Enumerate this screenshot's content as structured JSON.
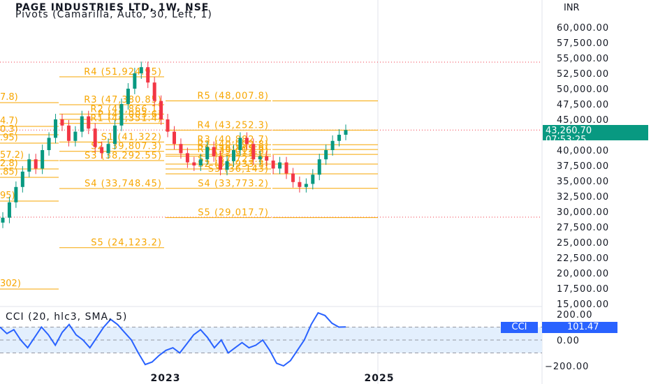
{
  "header": {
    "title": "PAGE INDUSTRIES LTD, 1W, NSE",
    "indicator": "Pivots (Camarilla, Auto, 30, Left, 1)"
  },
  "price_axis": {
    "currency": "INR",
    "ticks": [
      "60,000.00",
      "57,500.00",
      "55,000.00",
      "52,500.00",
      "50,000.00",
      "47,500.00",
      "45,000.00",
      "42,500.00",
      "40,000.00",
      "37,500.00",
      "35,000.00",
      "32,500.00",
      "30,000.00",
      "27,500.00",
      "25,000.00",
      "22,500.00",
      "20,000.00",
      "17,500.00",
      "15,000.00"
    ],
    "current_price": "43,260.70",
    "countdown": "07:53:25"
  },
  "time_axis": {
    "labels": [
      "2023",
      "2025"
    ]
  },
  "pivots": {
    "left_labels": [
      "7.8)",
      "4.7)",
      "0.3)",
      ".95)",
      "57.2)",
      "2.8)",
      ".85)",
      "95)",
      "302)"
    ],
    "period1": [
      {
        "label": "R4 (51,924.95)",
        "value": 51924.95
      },
      {
        "label": "R3 (47,380.85)",
        "value": 47380.85
      },
      {
        "label": "R2 (45,866.1)",
        "value": 45866.1
      },
      {
        "label": "R1 (44,351.4)",
        "value": 44351.4
      },
      {
        "label": "P (45,003.6)",
        "value": 45003.6
      },
      {
        "label": "S1 (41,322)",
        "value": 41322
      },
      {
        "label": "S2 (39,807.3)",
        "value": 39807.3
      },
      {
        "label": "S3 (38,292.55)",
        "value": 38292.55
      },
      {
        "label": "S4 (33,748.45)",
        "value": 33748.45
      },
      {
        "label": "S5 (24,123.2)",
        "value": 24123.2
      }
    ],
    "period2": [
      {
        "label": "R5 (48,007.8)",
        "value": 48007.8
      },
      {
        "label": "R4 (43,252.3)",
        "value": 43252.3
      },
      {
        "label": "R3 (40,882.7)",
        "value": 40882.7
      },
      {
        "label": "R2 (40,092.8)",
        "value": 40092.8
      },
      {
        "label": "R1 (39,302.9)",
        "value": 39302.9
      },
      {
        "label": "P (39,011.8)",
        "value": 39011.8
      },
      {
        "label": "S1 (37,723.2)",
        "value": 37723.2
      },
      {
        "label": "S2 (36,933.3)",
        "value": 36933.3
      },
      {
        "label": "S3 (36,143)",
        "value": 36143
      },
      {
        "label": "S4 (33,773.2)",
        "value": 33773.2
      },
      {
        "label": "S5 (29,017.7)",
        "value": 29017.7
      }
    ]
  },
  "cci": {
    "label": "CCI (20, hlc3, SMA, 5)",
    "badge_name": "CCI",
    "badge_value": "101.47",
    "ticks": [
      "200.00",
      "0.00",
      "−200.00"
    ]
  },
  "colors": {
    "up": "#089981",
    "down": "#f23645",
    "pivot": "#f7a600",
    "cci_line": "#2962ff",
    "cci_band": "#e3effd"
  },
  "chart_data": {
    "type": "candlestick",
    "title": "PAGE INDUSTRIES LTD, 1W, NSE",
    "ylim": [
      15000,
      60000
    ],
    "last_price": 43260.7,
    "series": [
      {
        "name": "price",
        "values": [
          29000,
          31500,
          34000,
          36500,
          38500,
          37000,
          40000,
          42000,
          45000,
          44000,
          41500,
          43000,
          45500,
          43500,
          40500,
          39500,
          41000,
          44000,
          47500,
          50000,
          52500,
          53500,
          51000,
          48000,
          45000,
          43000,
          41000,
          39500,
          38000,
          37500,
          38500,
          40500,
          39000,
          36800,
          38200,
          40000,
          42000,
          41000,
          38500,
          39000,
          38300,
          37000,
          38000,
          36200,
          34800,
          34000,
          34500,
          36000,
          38500,
          40000,
          41500,
          42500,
          43260.7
        ]
      },
      {
        "name": "CCI (20, hlc3, SMA, 5)",
        "values": [
          100,
          50,
          80,
          0,
          -60,
          20,
          100,
          40,
          -40,
          60,
          120,
          40,
          0,
          -60,
          20,
          100,
          160,
          120,
          60,
          0,
          -100,
          -190,
          -170,
          -120,
          -80,
          -60,
          -100,
          -30,
          40,
          80,
          20,
          -60,
          0,
          -100,
          -60,
          -20,
          -60,
          -40,
          0,
          -80,
          -180,
          -200,
          -160,
          -80,
          0,
          120,
          210,
          190,
          130,
          100,
          101.47
        ]
      }
    ]
  }
}
